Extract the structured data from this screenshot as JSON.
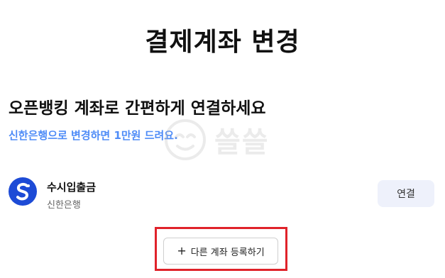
{
  "page": {
    "title": "결제계좌 변경"
  },
  "promo": {
    "heading": "오픈뱅킹 계좌로 간편하게 연결하세요",
    "subtext": "신한은행으로 변경하면 1만원 드려요."
  },
  "watermark": {
    "text": "쓸쓸"
  },
  "account": {
    "name": "수시입출금",
    "bank": "신한은행",
    "connect_label": "연결",
    "logo_icon": "shinhan-logo-icon",
    "logo_color": "#1d4bd6"
  },
  "actions": {
    "add_label": "다른 계좌 등록하기",
    "add_icon": "plus-icon",
    "highlight_color": "#e0222a"
  }
}
